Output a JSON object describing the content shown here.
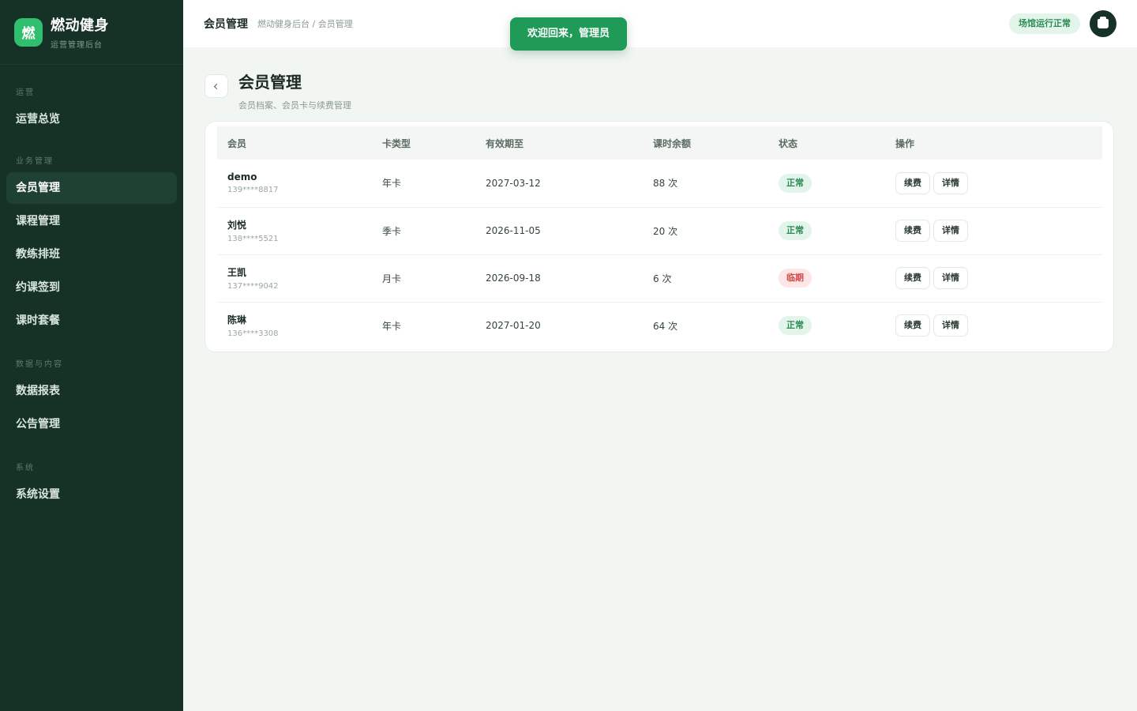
{
  "brand": {
    "logo_char": "燃",
    "title": "燃动健身",
    "subtitle": "运营管理后台"
  },
  "sidebar": {
    "groups": [
      {
        "label": "运营",
        "items": [
          {
            "label": "运营总览"
          }
        ]
      },
      {
        "label": "业务管理",
        "items": [
          {
            "label": "会员管理",
            "active": true
          },
          {
            "label": "课程管理"
          },
          {
            "label": "教练排班"
          },
          {
            "label": "约课签到"
          },
          {
            "label": "课时套餐"
          }
        ]
      },
      {
        "label": "数据与内容",
        "items": [
          {
            "label": "数据报表"
          },
          {
            "label": "公告管理"
          }
        ]
      },
      {
        "label": "系统",
        "items": [
          {
            "label": "系统设置"
          }
        ]
      }
    ]
  },
  "topbar": {
    "title": "会员管理",
    "breadcrumb": "燃动健身后台 / 会员管理",
    "status": "场馆运行正常"
  },
  "toast": {
    "text": "欢迎回来，管理员"
  },
  "page": {
    "title": "会员管理",
    "subtitle": "会员档案、会员卡与续费管理"
  },
  "table": {
    "headers": [
      "会员",
      "卡类型",
      "有效期至",
      "课时余额",
      "状态",
      "操作"
    ],
    "rows": [
      {
        "name": "demo",
        "phone": "139****8817",
        "card": "年卡",
        "expire": "2027-03-12",
        "balance": "88 次",
        "status": "正常",
        "status_type": "ok"
      },
      {
        "name": "刘悦",
        "phone": "138****5521",
        "card": "季卡",
        "expire": "2026-11-05",
        "balance": "20 次",
        "status": "正常",
        "status_type": "ok"
      },
      {
        "name": "王凯",
        "phone": "137****9042",
        "card": "月卡",
        "expire": "2026-09-18",
        "balance": "6 次",
        "status": "临期",
        "status_type": "warn"
      },
      {
        "name": "陈琳",
        "phone": "136****3308",
        "card": "年卡",
        "expire": "2027-01-20",
        "balance": "64 次",
        "status": "正常",
        "status_type": "ok"
      }
    ],
    "actions": {
      "renew": "续费",
      "detail": "详情"
    }
  },
  "colors": {
    "sidebar_bg": "#163126",
    "accent": "#1f9a57",
    "ok": "#2d8a55",
    "warn": "#d24a4a"
  }
}
